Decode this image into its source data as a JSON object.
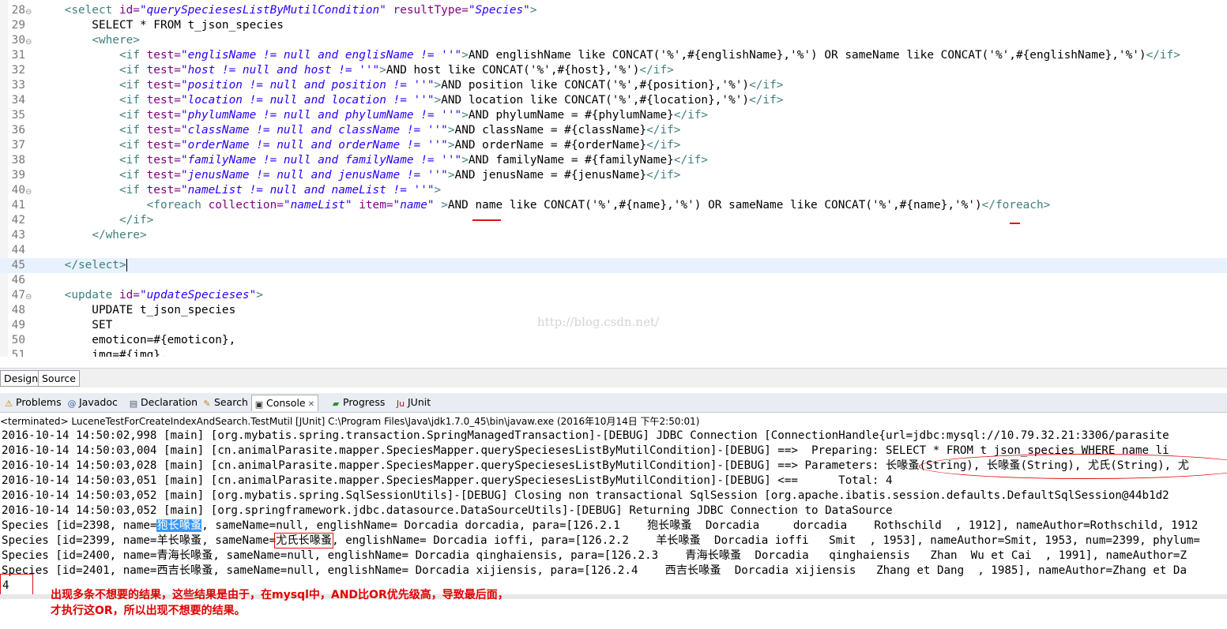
{
  "editor": {
    "lines": [
      {
        "n": "28",
        "fold": true,
        "segs": [
          [
            "",
            "    "
          ],
          [
            "tg",
            "<select "
          ],
          [
            "an",
            "id="
          ],
          [
            "av",
            "\"querySpeciesesListByMutilCondition\""
          ],
          [
            "an",
            " resultType="
          ],
          [
            "av",
            "\"Species\""
          ],
          [
            "tg",
            ">"
          ]
        ]
      },
      {
        "n": "29",
        "segs": [
          [
            "tx",
            "        SELECT * FROM t_json_species"
          ]
        ]
      },
      {
        "n": "30",
        "fold": true,
        "segs": [
          [
            "",
            "        "
          ],
          [
            "tg",
            "<where>"
          ]
        ]
      },
      {
        "n": "31",
        "segs": [
          [
            "",
            "            "
          ],
          [
            "tg",
            "<if "
          ],
          [
            "an",
            "test="
          ],
          [
            "av",
            "\"englisName != null and englisName != ''\""
          ],
          [
            "tg",
            ">"
          ],
          [
            "tx",
            "AND englishName like CONCAT('%',#{englishName},'%') OR sameName like CONCAT('%',#{englishName},'%')"
          ],
          [
            "tg",
            "</if>"
          ]
        ]
      },
      {
        "n": "32",
        "segs": [
          [
            "",
            "            "
          ],
          [
            "tg",
            "<if "
          ],
          [
            "an",
            "test="
          ],
          [
            "av",
            "\"host != null and host != ''\""
          ],
          [
            "tg",
            ">"
          ],
          [
            "tx",
            "AND host like CONCAT('%',#{host},'%')"
          ],
          [
            "tg",
            "</if>"
          ]
        ]
      },
      {
        "n": "33",
        "segs": [
          [
            "",
            "            "
          ],
          [
            "tg",
            "<if "
          ],
          [
            "an",
            "test="
          ],
          [
            "av",
            "\"position != null and position != ''\""
          ],
          [
            "tg",
            ">"
          ],
          [
            "tx",
            "AND position like CONCAT('%',#{position},'%')"
          ],
          [
            "tg",
            "</if>"
          ]
        ]
      },
      {
        "n": "34",
        "segs": [
          [
            "",
            "            "
          ],
          [
            "tg",
            "<if "
          ],
          [
            "an",
            "test="
          ],
          [
            "av",
            "\"location != null and location != ''\""
          ],
          [
            "tg",
            ">"
          ],
          [
            "tx",
            "AND location like CONCAT('%',#{location},'%')"
          ],
          [
            "tg",
            "</if>"
          ]
        ]
      },
      {
        "n": "35",
        "segs": [
          [
            "",
            "            "
          ],
          [
            "tg",
            "<if "
          ],
          [
            "an",
            "test="
          ],
          [
            "av",
            "\"phylumName != null and phylumName != ''\""
          ],
          [
            "tg",
            ">"
          ],
          [
            "tx",
            "AND phylumName = #{phylumName}"
          ],
          [
            "tg",
            "</if>"
          ]
        ]
      },
      {
        "n": "36",
        "segs": [
          [
            "",
            "            "
          ],
          [
            "tg",
            "<if "
          ],
          [
            "an",
            "test="
          ],
          [
            "av",
            "\"className != null and className != ''\""
          ],
          [
            "tg",
            ">"
          ],
          [
            "tx",
            "AND className = #{className}"
          ],
          [
            "tg",
            "</if>"
          ]
        ]
      },
      {
        "n": "37",
        "segs": [
          [
            "",
            "            "
          ],
          [
            "tg",
            "<if "
          ],
          [
            "an",
            "test="
          ],
          [
            "av",
            "\"orderName != null and orderName != ''\""
          ],
          [
            "tg",
            ">"
          ],
          [
            "tx",
            "AND orderName = #{orderName}"
          ],
          [
            "tg",
            "</if>"
          ]
        ]
      },
      {
        "n": "38",
        "segs": [
          [
            "",
            "            "
          ],
          [
            "tg",
            "<if "
          ],
          [
            "an",
            "test="
          ],
          [
            "av",
            "\"familyName != null and familyName != ''\""
          ],
          [
            "tg",
            ">"
          ],
          [
            "tx",
            "AND familyName = #{familyName}"
          ],
          [
            "tg",
            "</if>"
          ]
        ]
      },
      {
        "n": "39",
        "segs": [
          [
            "",
            "            "
          ],
          [
            "tg",
            "<if "
          ],
          [
            "an",
            "test="
          ],
          [
            "av",
            "\"jenusName != null and jenusName != ''\""
          ],
          [
            "tg",
            ">"
          ],
          [
            "tx",
            "AND jenusName = #{jenusName}"
          ],
          [
            "tg",
            "</if>"
          ]
        ]
      },
      {
        "n": "40",
        "fold": true,
        "segs": [
          [
            "",
            "            "
          ],
          [
            "tg",
            "<if "
          ],
          [
            "an",
            "test="
          ],
          [
            "av",
            "\"nameList != null and nameList != ''\""
          ],
          [
            "tg",
            ">"
          ]
        ]
      },
      {
        "n": "41",
        "segs": [
          [
            "",
            "                "
          ],
          [
            "tg",
            "<foreach "
          ],
          [
            "an",
            "collection="
          ],
          [
            "av",
            "\"nameList\""
          ],
          [
            "an",
            " item="
          ],
          [
            "av",
            "\"name\""
          ],
          [
            "tg",
            " >"
          ],
          [
            "tx",
            "AND name like CONCAT('%',#{name},'%') OR sameName like CONCAT('%',#{name},'%')"
          ],
          [
            "tg",
            "</foreach>"
          ]
        ]
      },
      {
        "n": "42",
        "segs": [
          [
            "",
            "            "
          ],
          [
            "tg",
            "</if>"
          ]
        ]
      },
      {
        "n": "43",
        "segs": [
          [
            "",
            "        "
          ],
          [
            "tg",
            "</where>"
          ]
        ]
      },
      {
        "n": "44",
        "segs": []
      },
      {
        "n": "45",
        "current": true,
        "caret": true,
        "segs": [
          [
            "",
            "    "
          ],
          [
            "tg",
            "</select>"
          ]
        ]
      },
      {
        "n": "46",
        "segs": []
      },
      {
        "n": "47",
        "fold": true,
        "segs": [
          [
            "",
            "    "
          ],
          [
            "tg",
            "<update "
          ],
          [
            "an",
            "id="
          ],
          [
            "av",
            "\"updateSpecieses\""
          ],
          [
            "tg",
            ">"
          ]
        ]
      },
      {
        "n": "48",
        "segs": [
          [
            "tx",
            "        UPDATE t_json_species"
          ]
        ]
      },
      {
        "n": "49",
        "segs": [
          [
            "tx",
            "        SET"
          ]
        ]
      },
      {
        "n": "50",
        "segs": [
          [
            "tx",
            "        emoticon=#{emoticon},"
          ]
        ]
      },
      {
        "n": "51",
        "segs": [
          [
            "tx",
            "        img=#{img},"
          ]
        ]
      }
    ]
  },
  "editor_tabs": [
    "Design",
    "Source"
  ],
  "panel_tabs": [
    {
      "label": "Problems",
      "icon": "problems-icon",
      "glyph": "⚠",
      "color": "#c08000"
    },
    {
      "label": "Javadoc",
      "icon": "javadoc-icon",
      "glyph": "@",
      "color": "#4060a0"
    },
    {
      "label": "Declaration",
      "icon": "declaration-icon",
      "glyph": "▤",
      "color": "#506070"
    },
    {
      "label": "Search",
      "icon": "search-icon",
      "glyph": "✎",
      "color": "#c08020"
    },
    {
      "label": "Console",
      "icon": "console-icon",
      "glyph": "▣",
      "color": "#303030",
      "active": true,
      "close": "✕"
    },
    {
      "label": "Progress",
      "icon": "progress-icon",
      "glyph": "▰",
      "color": "#2f8f2f"
    },
    {
      "label": "JUnit",
      "icon": "junit-icon",
      "glyph": "Ju",
      "color": "#9a2020"
    }
  ],
  "console_status": "<terminated> LuceneTestForCreateIndexAndSearch.TestMutil [JUnit] C:\\Program Files\\Java\\jdk1.7.0_45\\bin\\javaw.exe (2016年10月14日 下午2:50:01)",
  "console_lines": [
    "2016-10-14 14:50:02,998 [main] [org.mybatis.spring.transaction.SpringManagedTransaction]-[DEBUG] JDBC Connection [ConnectionHandle{url=jdbc:mysql://10.79.32.21:3306/parasite",
    "2016-10-14 14:50:03,004 [main] [cn.animalParasite.mapper.SpeciesMapper.querySpeciesesListByMutilCondition]-[DEBUG] ==>  Preparing: SELECT * FROM t_json_species WHERE name li",
    "2016-10-14 14:50:03,028 [main] [cn.animalParasite.mapper.SpeciesMapper.querySpeciesesListByMutilCondition]-[DEBUG] ==> Parameters: 长喙蚤(String), 长喙蚤(String), 尤氏(String), 尤",
    "2016-10-14 14:50:03,051 [main] [cn.animalParasite.mapper.SpeciesMapper.querySpeciesesListByMutilCondition]-[DEBUG] <==      Total: 4",
    "2016-10-14 14:50:03,052 [main] [org.mybatis.spring.SqlSessionUtils]-[DEBUG] Closing non transactional SqlSession [org.apache.ibatis.session.defaults.DefaultSqlSession@44b1d2",
    "2016-10-14 14:50:03,052 [main] [org.springframework.jdbc.datasource.DataSourceUtils]-[DEBUG] Returning JDBC Connection to DataSource"
  ],
  "species_lines": [
    {
      "pre": "Species [id=2398, name=",
      "sel": "狍长喙蚤",
      "post": ", sameName=null, englishName= Dorcadia dorcadia, para=[126.2.1    狍长喙蚤  Dorcadia     dorcadia    Rothschild  , 1912], nameAuthor=Rothschild, 1912"
    },
    {
      "pre": "Species [id=2399, name=羊长喙蚤, sameName=",
      "boxed": "尤氏长喙蚤",
      "post": ", englishName= Dorcadia ioffi, para=[126.2.2    羊长喙蚤  Dorcadia ioffi   Smit  , 1953], nameAuthor=Smit, 1953, num=2399, phylum="
    },
    {
      "pre": "Species [id=2400, name=青海长喙蚤, sameName=null, englishName= Dorcadia qinghaiensis, para=[126.2.3    青海长喙蚤  Dorcadia   qinghaiensis   Zhan  Wu et Cai  , 1991], nameAuthor=Z"
    },
    {
      "pre": "Species [id=2401, name=西吉长喙蚤, sameName=null, englishName= Dorcadia xijiensis, para=[126.2.4    西吉长喙蚤  Dorcadia xijiensis   Zhang et Dang  , 1985], nameAuthor=Zhang et Da"
    }
  ],
  "console_count": "4",
  "annotation": {
    "line1": "出现多条不想要的结果，这些结果是由于，在mysql中，AND比OR优先级高，导致最后面，",
    "line2": "才执行这OR，所以出现不想要的结果。",
    "color": "#e00000"
  },
  "watermark": "http://blog.csdn.net/"
}
